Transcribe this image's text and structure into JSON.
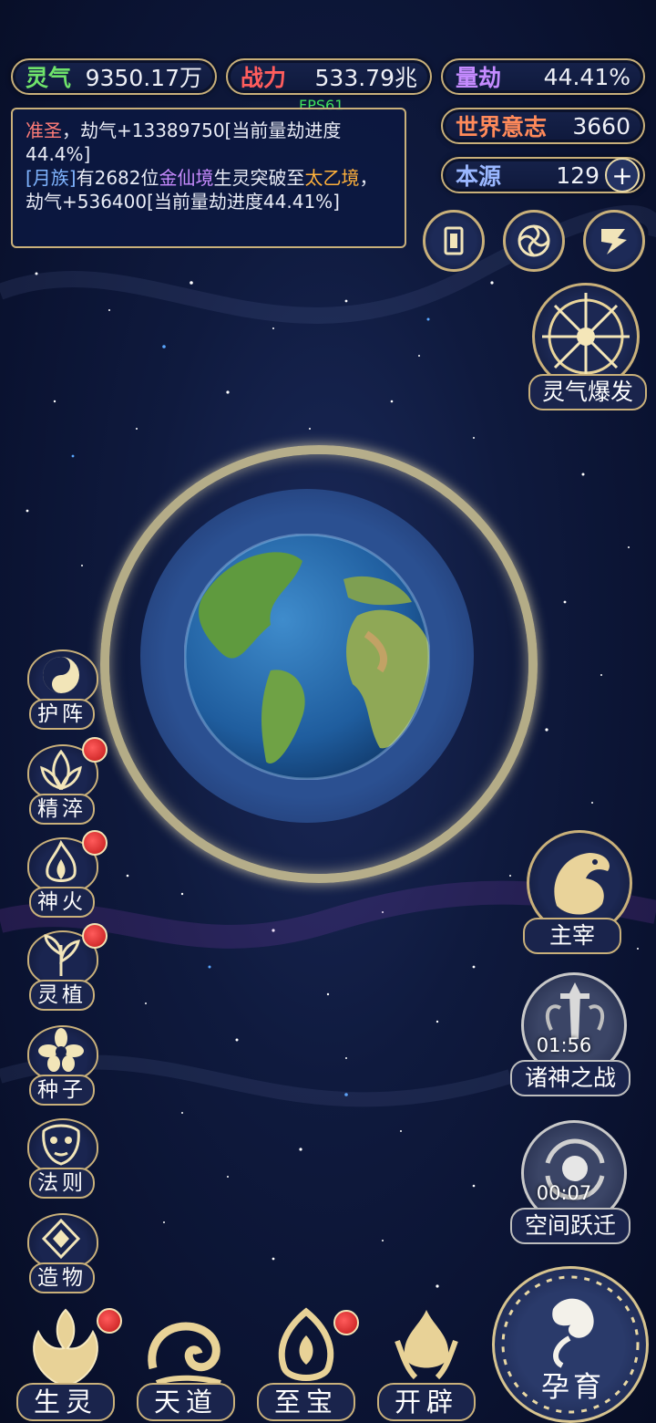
{
  "stats": {
    "lingqi": {
      "label": "灵气",
      "value": "9350.17万",
      "color": "#6fe36b"
    },
    "zhanli": {
      "label": "战力",
      "value": "533.79兆",
      "color": "#ff5d5d"
    },
    "liangjie": {
      "label": "量劫",
      "value": "44.41%",
      "color": "#c58bff"
    },
    "world_will": {
      "label": "世界意志",
      "value": "3660",
      "color": "#ff8a5a"
    },
    "benyuan": {
      "label": "本源",
      "value": "129",
      "color": "#9ab7ff"
    }
  },
  "fps": "FPS61",
  "log": {
    "line1": {
      "a": "准圣",
      "b": "，劫气+13389750[当前量劫进度44.4%]"
    },
    "line2": {
      "a": "[月族]",
      "b": "有2682位",
      "c": "金仙境",
      "d": "生灵突破至",
      "e": "太乙境",
      "f": "，劫气+536400[当前量劫进度44.41%]"
    }
  },
  "icons": {
    "plus": "+",
    "card": "card-icon",
    "vortex": "vortex-icon",
    "flag": "flag-icon"
  },
  "burst_label": "灵气爆发",
  "left_menu": [
    {
      "label": "护阵",
      "icon": "yinyang-icon",
      "badge": false
    },
    {
      "label": "精淬",
      "icon": "lotus-icon",
      "badge": true
    },
    {
      "label": "神火",
      "icon": "flame-icon",
      "badge": true
    },
    {
      "label": "灵植",
      "icon": "plant-icon",
      "badge": true
    },
    {
      "label": "种子",
      "icon": "flower-icon",
      "badge": false
    },
    {
      "label": "法则",
      "icon": "mask-icon",
      "badge": false
    },
    {
      "label": "造物",
      "icon": "diamond-icon",
      "badge": false
    }
  ],
  "right_menu": [
    {
      "label": "主宰",
      "icon": "dragon-icon",
      "timer": ""
    },
    {
      "label": "诸神之战",
      "icon": "sword-icon",
      "timer": "01:56"
    },
    {
      "label": "空间跃迁",
      "icon": "portal-icon",
      "timer": "00:07"
    }
  ],
  "bottom_nav": [
    {
      "label": "生灵",
      "icon": "phoenix-icon",
      "badge": true
    },
    {
      "label": "天道",
      "icon": "cloud-swirl-icon",
      "badge": false
    },
    {
      "label": "至宝",
      "icon": "treasure-icon",
      "badge": true
    },
    {
      "label": "开辟",
      "icon": "fire-burst-icon",
      "badge": false
    }
  ],
  "yun_label": "孕育"
}
